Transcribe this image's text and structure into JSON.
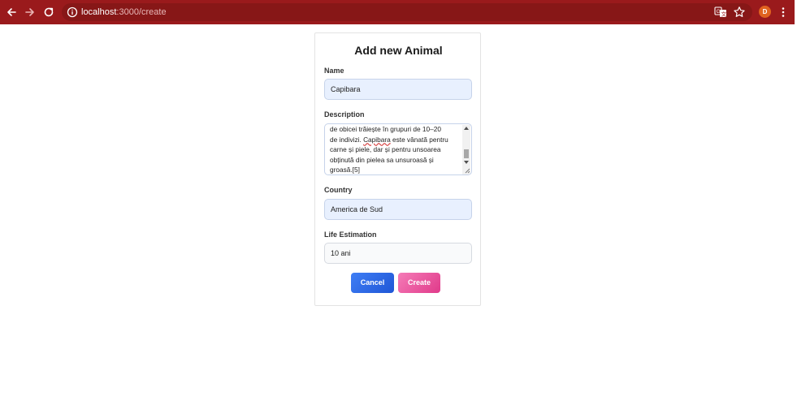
{
  "browser": {
    "url_host": "localhost",
    "url_path": ":3000/create",
    "profile_initial": "D",
    "icons": [
      "back-arrow-icon",
      "forward-arrow-icon",
      "reload-icon",
      "info-icon",
      "translate-icon",
      "star-icon",
      "kebab-menu-icon"
    ],
    "colors": {
      "toolbar": "#9a1a1c",
      "omnibox": "#871717",
      "avatar": "#e0631f"
    }
  },
  "form": {
    "title": "Add new Animal",
    "name_label": "Name",
    "name_value": "Capibara",
    "description_label": "Description",
    "description_lines": [
      "de obicei trăiește în grupuri de 10–20",
      "de indivizi.",
      "Capibara",
      "este vânată pentru",
      "carne și piele, dar și pentru unsoarea",
      "obținută din pielea sa unsuroasă și",
      "groasă.[5]"
    ],
    "country_label": "Country",
    "country_value": "America de Sud",
    "life_label": "Life Estimation",
    "life_value": "10 ani",
    "cancel_label": "Cancel",
    "create_label": "Create",
    "colors": {
      "cancel_button": "#2563eb",
      "create_button": "#ec4899",
      "autofill_bg": "#e8f0fe"
    }
  }
}
